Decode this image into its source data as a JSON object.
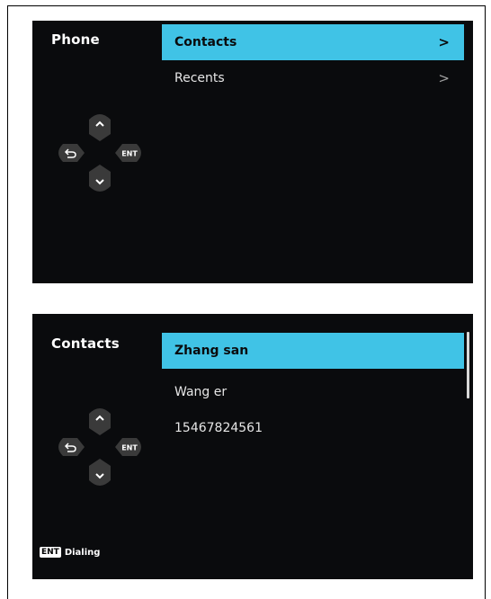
{
  "panels": [
    {
      "title": "Phone",
      "items": [
        {
          "label": "Contacts",
          "chevron": ">"
        },
        {
          "label": "Recents",
          "chevron": ">"
        }
      ],
      "dpad": {
        "up_icon": "chevron-up-icon",
        "down_icon": "chevron-down-icon",
        "back_icon": "back-arrow-icon",
        "enter": "ENT"
      }
    },
    {
      "title": "Contacts",
      "items": [
        {
          "label": "Zhang san"
        },
        {
          "label": "Wang er"
        },
        {
          "label": "15467824561"
        }
      ],
      "dpad": {
        "up_icon": "chevron-up-icon",
        "down_icon": "chevron-down-icon",
        "back_icon": "back-arrow-icon",
        "enter": "ENT"
      },
      "hint": {
        "key": "ENT",
        "label": "Dialing"
      }
    }
  ],
  "colors": {
    "screen_bg": "#0a0b0d",
    "accent": "#40c3e6",
    "button": "#3a3a3a"
  }
}
